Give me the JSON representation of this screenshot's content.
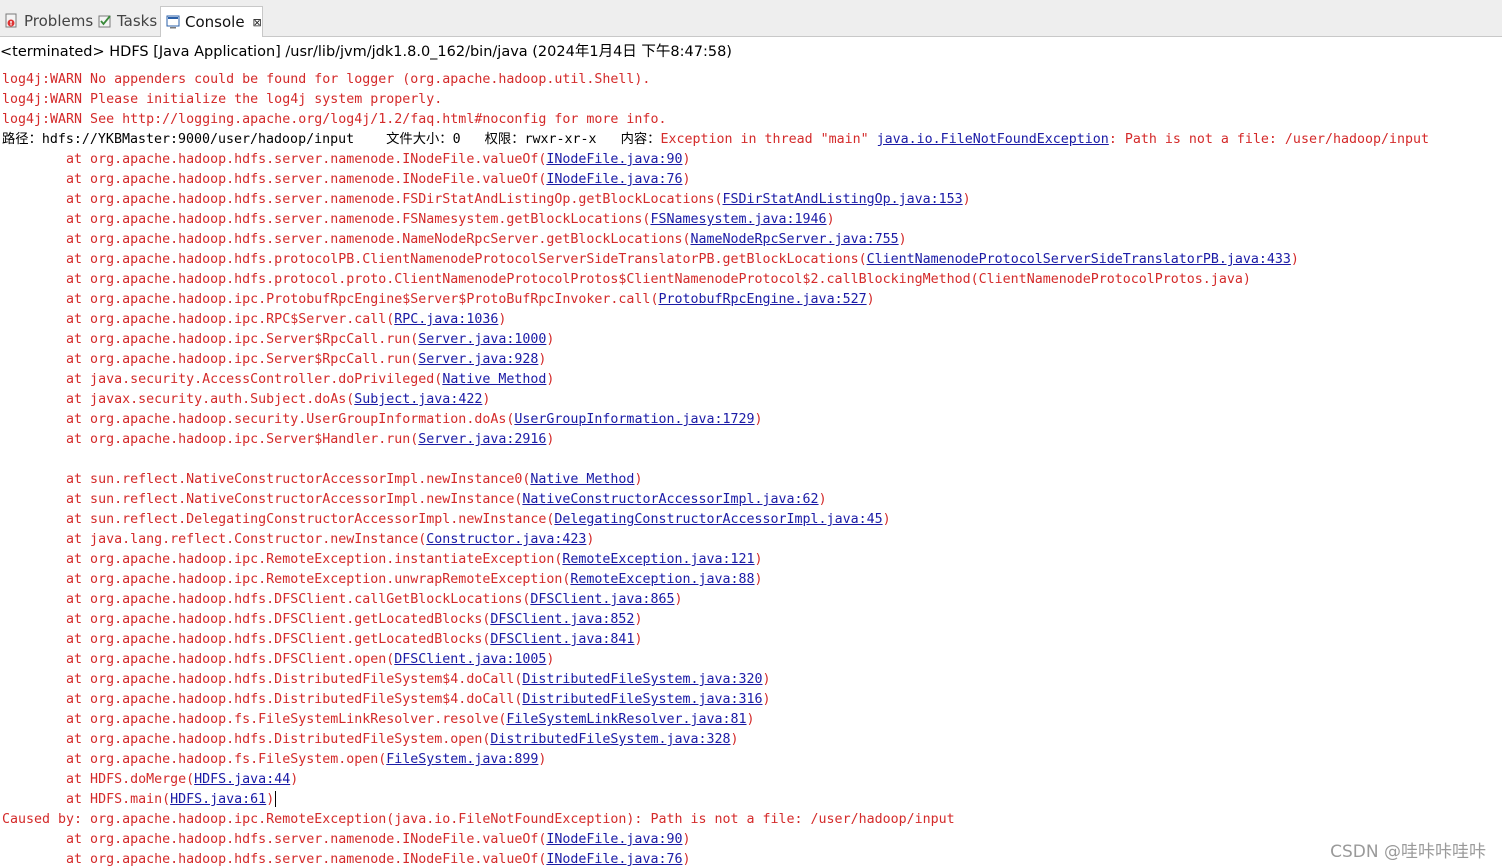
{
  "tabs": [
    {
      "label": "Problems",
      "icon": "problems-icon",
      "active": false
    },
    {
      "label": "Tasks",
      "icon": "tasks-icon",
      "active": false
    },
    {
      "label": "Console",
      "icon": "console-icon",
      "active": true,
      "close": "⊠"
    }
  ],
  "header": "<terminated> HDFS [Java Application] /usr/lib/jvm/jdk1.8.0_162/bin/java (2024年1月4日 下午8:47:58)",
  "colors": {
    "error": "#d42a2a",
    "link": "#1a1aa6",
    "normal": "#000000"
  },
  "console": {
    "lines": [
      {
        "segments": [
          {
            "t": "log4j:WARN No appenders could be found for logger (org.apache.hadoop.util.Shell)."
          }
        ]
      },
      {
        "segments": [
          {
            "t": "log4j:WARN Please initialize the log4j system properly."
          }
        ]
      },
      {
        "segments": [
          {
            "t": "log4j:WARN See http://logging.apache.org/log4j/1.2/faq.html#noconfig for more info."
          }
        ]
      },
      {
        "segments": [
          {
            "t": "路径：hdfs://YKBMaster:9000/user/hadoop/input    文件大小：0   权限：rwxr-xr-x   内容：",
            "k": "black"
          },
          {
            "t": "Exception in thread \"main\" "
          },
          {
            "t": "java.io.FileNotFoundException",
            "k": "link"
          },
          {
            "t": ": Path is not a file: /user/hadoop/input"
          }
        ]
      },
      {
        "segments": [
          {
            "t": "\tat org.apache.hadoop.hdfs.server.namenode.INodeFile.valueOf("
          },
          {
            "t": "INodeFile.java:90",
            "k": "link"
          },
          {
            "t": ")"
          }
        ]
      },
      {
        "segments": [
          {
            "t": "\tat org.apache.hadoop.hdfs.server.namenode.INodeFile.valueOf("
          },
          {
            "t": "INodeFile.java:76",
            "k": "link"
          },
          {
            "t": ")"
          }
        ]
      },
      {
        "segments": [
          {
            "t": "\tat org.apache.hadoop.hdfs.server.namenode.FSDirStatAndListingOp.getBlockLocations("
          },
          {
            "t": "FSDirStatAndListingOp.java:153",
            "k": "link"
          },
          {
            "t": ")"
          }
        ]
      },
      {
        "segments": [
          {
            "t": "\tat org.apache.hadoop.hdfs.server.namenode.FSNamesystem.getBlockLocations("
          },
          {
            "t": "FSNamesystem.java:1946",
            "k": "link"
          },
          {
            "t": ")"
          }
        ]
      },
      {
        "segments": [
          {
            "t": "\tat org.apache.hadoop.hdfs.server.namenode.NameNodeRpcServer.getBlockLocations("
          },
          {
            "t": "NameNodeRpcServer.java:755",
            "k": "link"
          },
          {
            "t": ")"
          }
        ]
      },
      {
        "segments": [
          {
            "t": "\tat org.apache.hadoop.hdfs.protocolPB.ClientNamenodeProtocolServerSideTranslatorPB.getBlockLocations("
          },
          {
            "t": "ClientNamenodeProtocolServerSideTranslatorPB.java:433",
            "k": "link"
          },
          {
            "t": ")"
          }
        ]
      },
      {
        "segments": [
          {
            "t": "\tat org.apache.hadoop.hdfs.protocol.proto.ClientNamenodeProtocolProtos$ClientNamenodeProtocol$2.callBlockingMethod(ClientNamenodeProtocolProtos.java)"
          }
        ]
      },
      {
        "segments": [
          {
            "t": "\tat org.apache.hadoop.ipc.ProtobufRpcEngine$Server$ProtoBufRpcInvoker.call("
          },
          {
            "t": "ProtobufRpcEngine.java:527",
            "k": "link"
          },
          {
            "t": ")"
          }
        ]
      },
      {
        "segments": [
          {
            "t": "\tat org.apache.hadoop.ipc.RPC$Server.call("
          },
          {
            "t": "RPC.java:1036",
            "k": "link"
          },
          {
            "t": ")"
          }
        ]
      },
      {
        "segments": [
          {
            "t": "\tat org.apache.hadoop.ipc.Server$RpcCall.run("
          },
          {
            "t": "Server.java:1000",
            "k": "link"
          },
          {
            "t": ")"
          }
        ]
      },
      {
        "segments": [
          {
            "t": "\tat org.apache.hadoop.ipc.Server$RpcCall.run("
          },
          {
            "t": "Server.java:928",
            "k": "link"
          },
          {
            "t": ")"
          }
        ]
      },
      {
        "segments": [
          {
            "t": "\tat java.security.AccessController.doPrivileged("
          },
          {
            "t": "Native Method",
            "k": "link"
          },
          {
            "t": ")"
          }
        ]
      },
      {
        "segments": [
          {
            "t": "\tat javax.security.auth.Subject.doAs("
          },
          {
            "t": "Subject.java:422",
            "k": "link"
          },
          {
            "t": ")"
          }
        ]
      },
      {
        "segments": [
          {
            "t": "\tat org.apache.hadoop.security.UserGroupInformation.doAs("
          },
          {
            "t": "UserGroupInformation.java:1729",
            "k": "link"
          },
          {
            "t": ")"
          }
        ]
      },
      {
        "segments": [
          {
            "t": "\tat org.apache.hadoop.ipc.Server$Handler.run("
          },
          {
            "t": "Server.java:2916",
            "k": "link"
          },
          {
            "t": ")"
          }
        ]
      },
      {
        "segments": [
          {
            "t": ""
          }
        ]
      },
      {
        "segments": [
          {
            "t": "\tat sun.reflect.NativeConstructorAccessorImpl.newInstance0("
          },
          {
            "t": "Native Method",
            "k": "link"
          },
          {
            "t": ")"
          }
        ]
      },
      {
        "segments": [
          {
            "t": "\tat sun.reflect.NativeConstructorAccessorImpl.newInstance("
          },
          {
            "t": "NativeConstructorAccessorImpl.java:62",
            "k": "link"
          },
          {
            "t": ")"
          }
        ]
      },
      {
        "segments": [
          {
            "t": "\tat sun.reflect.DelegatingConstructorAccessorImpl.newInstance("
          },
          {
            "t": "DelegatingConstructorAccessorImpl.java:45",
            "k": "link"
          },
          {
            "t": ")"
          }
        ]
      },
      {
        "segments": [
          {
            "t": "\tat java.lang.reflect.Constructor.newInstance("
          },
          {
            "t": "Constructor.java:423",
            "k": "link"
          },
          {
            "t": ")"
          }
        ]
      },
      {
        "segments": [
          {
            "t": "\tat org.apache.hadoop.ipc.RemoteException.instantiateException("
          },
          {
            "t": "RemoteException.java:121",
            "k": "link"
          },
          {
            "t": ")"
          }
        ]
      },
      {
        "segments": [
          {
            "t": "\tat org.apache.hadoop.ipc.RemoteException.unwrapRemoteException("
          },
          {
            "t": "RemoteException.java:88",
            "k": "link"
          },
          {
            "t": ")"
          }
        ]
      },
      {
        "segments": [
          {
            "t": "\tat org.apache.hadoop.hdfs.DFSClient.callGetBlockLocations("
          },
          {
            "t": "DFSClient.java:865",
            "k": "link"
          },
          {
            "t": ")"
          }
        ]
      },
      {
        "segments": [
          {
            "t": "\tat org.apache.hadoop.hdfs.DFSClient.getLocatedBlocks("
          },
          {
            "t": "DFSClient.java:852",
            "k": "link"
          },
          {
            "t": ")"
          }
        ]
      },
      {
        "segments": [
          {
            "t": "\tat org.apache.hadoop.hdfs.DFSClient.getLocatedBlocks("
          },
          {
            "t": "DFSClient.java:841",
            "k": "link"
          },
          {
            "t": ")"
          }
        ]
      },
      {
        "segments": [
          {
            "t": "\tat org.apache.hadoop.hdfs.DFSClient.open("
          },
          {
            "t": "DFSClient.java:1005",
            "k": "link"
          },
          {
            "t": ")"
          }
        ]
      },
      {
        "segments": [
          {
            "t": "\tat org.apache.hadoop.hdfs.DistributedFileSystem$4.doCall("
          },
          {
            "t": "DistributedFileSystem.java:320",
            "k": "link"
          },
          {
            "t": ")"
          }
        ]
      },
      {
        "segments": [
          {
            "t": "\tat org.apache.hadoop.hdfs.DistributedFileSystem$4.doCall("
          },
          {
            "t": "DistributedFileSystem.java:316",
            "k": "link"
          },
          {
            "t": ")"
          }
        ]
      },
      {
        "segments": [
          {
            "t": "\tat org.apache.hadoop.fs.FileSystemLinkResolver.resolve("
          },
          {
            "t": "FileSystemLinkResolver.java:81",
            "k": "link"
          },
          {
            "t": ")"
          }
        ]
      },
      {
        "segments": [
          {
            "t": "\tat org.apache.hadoop.hdfs.DistributedFileSystem.open("
          },
          {
            "t": "DistributedFileSystem.java:328",
            "k": "link"
          },
          {
            "t": ")"
          }
        ]
      },
      {
        "segments": [
          {
            "t": "\tat org.apache.hadoop.fs.FileSystem.open("
          },
          {
            "t": "FileSystem.java:899",
            "k": "link"
          },
          {
            "t": ")"
          }
        ]
      },
      {
        "segments": [
          {
            "t": "\tat HDFS.doMerge("
          },
          {
            "t": "HDFS.java:44",
            "k": "link"
          },
          {
            "t": ")"
          }
        ]
      },
      {
        "segments": [
          {
            "t": "\tat HDFS.main("
          },
          {
            "t": "HDFS.java:61",
            "k": "link"
          },
          {
            "t": ")"
          }
        ],
        "caret": true
      },
      {
        "segments": [
          {
            "t": "Caused by: org.apache.hadoop.ipc.RemoteException(java.io.FileNotFoundException): Path is not a file: /user/hadoop/input"
          }
        ]
      },
      {
        "segments": [
          {
            "t": "\tat org.apache.hadoop.hdfs.server.namenode.INodeFile.valueOf("
          },
          {
            "t": "INodeFile.java:90",
            "k": "link"
          },
          {
            "t": ")"
          }
        ]
      },
      {
        "segments": [
          {
            "t": "\tat org.apache.hadoop.hdfs.server.namenode.INodeFile.valueOf("
          },
          {
            "t": "INodeFile.java:76",
            "k": "link"
          },
          {
            "t": ")"
          }
        ]
      }
    ]
  },
  "watermark": "CSDN @哇咔咔哇咔"
}
